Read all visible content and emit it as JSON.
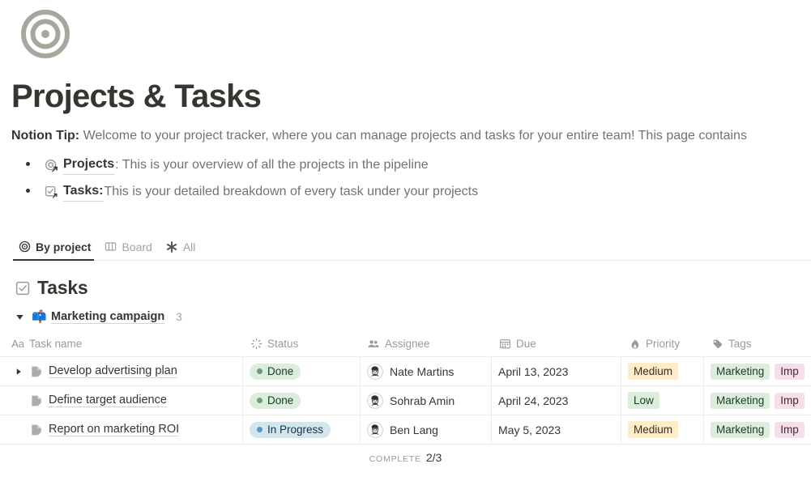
{
  "page": {
    "icon": "bullseye-target-icon",
    "title": "Projects & Tasks",
    "intro_lead": "Notion Tip:",
    "intro_rest": " Welcome to your project tracker, where you can manage projects and tasks for your entire team! This page contains",
    "bullets": [
      {
        "icon": "target-link-icon",
        "link": "Projects",
        "rest": ": This is your overview of all the projects in the pipeline"
      },
      {
        "icon": "checkbox-link-icon",
        "link": "Tasks:",
        "rest": " This is your detailed breakdown of every task under your projects"
      }
    ]
  },
  "tabs": [
    {
      "label": "By project",
      "icon": "bullseye-icon",
      "active": true
    },
    {
      "label": "Board",
      "icon": "columns-icon",
      "active": false
    },
    {
      "label": "All",
      "icon": "asterisk-icon",
      "active": false
    }
  ],
  "database": {
    "icon": "checked-box-icon",
    "title": "Tasks",
    "group": {
      "caret": "caret-down-icon",
      "emoji": "📫",
      "name": "Marketing campaign",
      "count": "3"
    },
    "columns": [
      {
        "key": "name",
        "label": "Task name",
        "icon": "aa-text-icon"
      },
      {
        "key": "status",
        "label": "Status",
        "icon": "status-spinner-icon"
      },
      {
        "key": "assignee",
        "label": "Assignee",
        "icon": "people-icon"
      },
      {
        "key": "due",
        "label": "Due",
        "icon": "calendar-icon"
      },
      {
        "key": "priority",
        "label": "Priority",
        "icon": "flame-icon"
      },
      {
        "key": "tags",
        "label": "Tags",
        "icon": "tag-icon"
      }
    ],
    "rows": [
      {
        "expandable": true,
        "name": "Develop advertising plan",
        "status": "Done",
        "status_color": "#dbeddb",
        "status_text_color": "#1c3829",
        "status_dot": "#6c9b7d",
        "assignee": "Nate Martins",
        "due": "April 13, 2023",
        "priority": "Medium",
        "priority_bg": "#fdecc8",
        "priority_text": "#402c1b",
        "tags": [
          {
            "label": "Marketing",
            "bg": "#dbeddb",
            "text": "#1c3829"
          },
          {
            "label": "Imp",
            "bg": "#f5e0e9",
            "text": "#4c2337"
          }
        ]
      },
      {
        "expandable": false,
        "name": "Define target audience",
        "status": "Done",
        "status_color": "#dbeddb",
        "status_text_color": "#1c3829",
        "status_dot": "#6c9b7d",
        "assignee": "Sohrab Amin",
        "due": "April 24, 2023",
        "priority": "Low",
        "priority_bg": "#dbeddb",
        "priority_text": "#1c3829",
        "tags": [
          {
            "label": "Marketing",
            "bg": "#dbeddb",
            "text": "#1c3829"
          },
          {
            "label": "Imp",
            "bg": "#f5e0e9",
            "text": "#4c2337"
          }
        ]
      },
      {
        "expandable": false,
        "name": "Report on marketing ROI",
        "status": "In Progress",
        "status_color": "#d3e5ef",
        "status_text_color": "#183347",
        "status_dot": "#5b97bd",
        "assignee": "Ben Lang",
        "due": "May 5, 2023",
        "priority": "Medium",
        "priority_bg": "#fdecc8",
        "priority_text": "#402c1b",
        "tags": [
          {
            "label": "Marketing",
            "bg": "#dbeddb",
            "text": "#1c3829"
          },
          {
            "label": "Imp",
            "bg": "#f5e0e9",
            "text": "#4c2337"
          }
        ]
      }
    ],
    "footer": {
      "label": "COMPLETE",
      "value": "2/3"
    }
  }
}
